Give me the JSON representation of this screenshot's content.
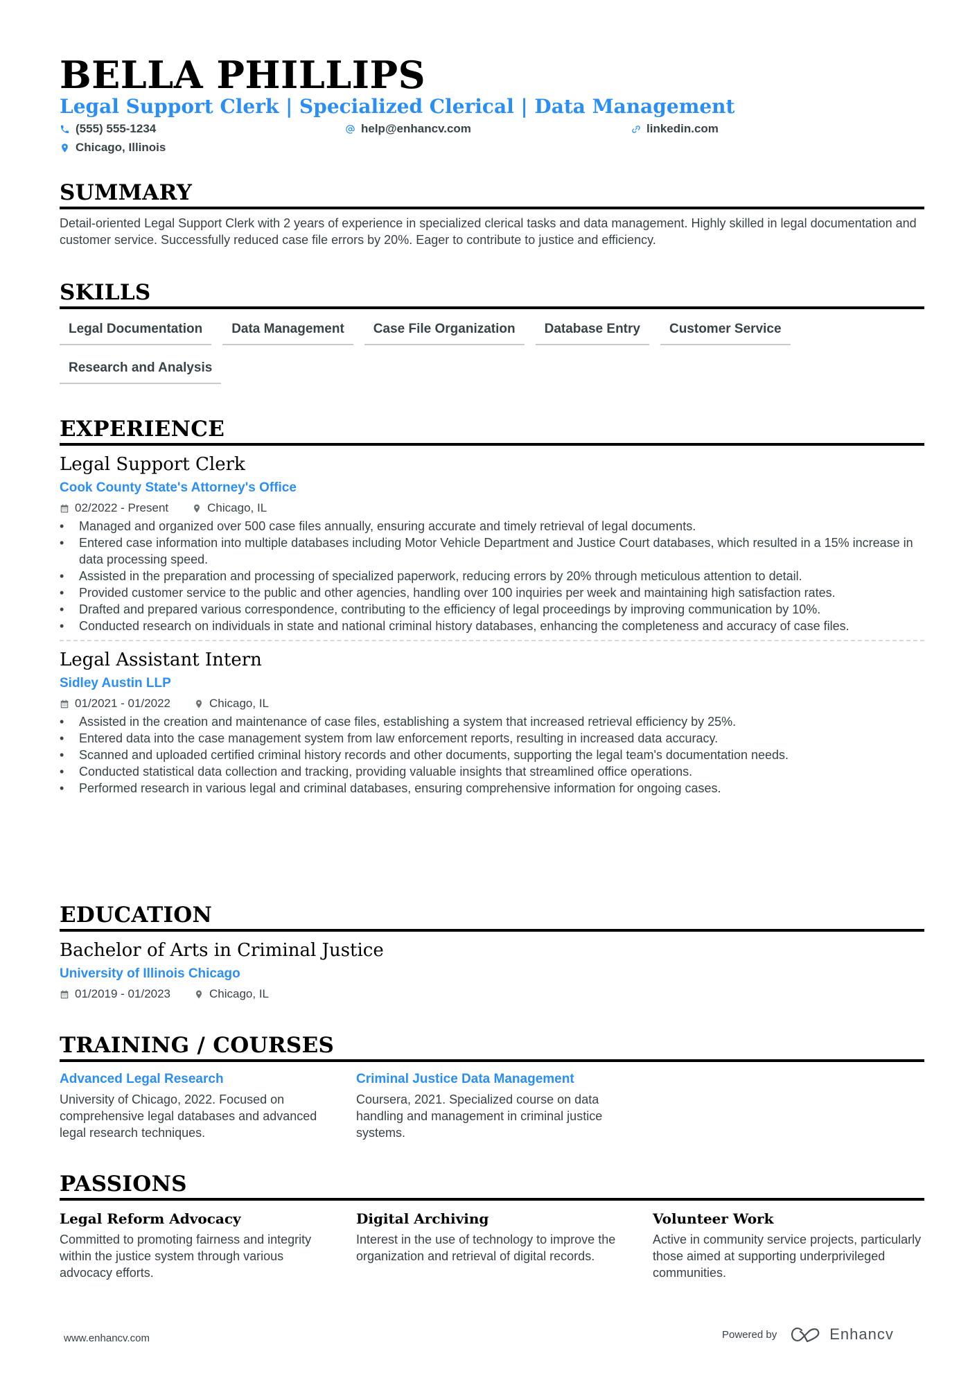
{
  "header": {
    "name": "BELLA PHILLIPS",
    "headline": "Legal Support Clerk | Specialized Clerical | Data Management",
    "contacts": {
      "phone": {
        "icon": "phone-icon",
        "value": "(555) 555-1234"
      },
      "email": {
        "icon": "at-icon",
        "value": "help@enhancv.com"
      },
      "linkedin": {
        "icon": "link-icon",
        "value": "linkedin.com"
      },
      "location": {
        "icon": "map-pin-icon",
        "value": "Chicago, Illinois"
      }
    }
  },
  "summary": {
    "title": "SUMMARY",
    "text": "Detail-oriented Legal Support Clerk with 2 years of experience in specialized clerical tasks and data management. Highly skilled in legal documentation and customer service. Successfully reduced case file errors by 20%. Eager to contribute to justice and efficiency."
  },
  "skills": {
    "title": "SKILLS",
    "items": [
      "Legal Documentation",
      "Data Management",
      "Case File Organization",
      "Database Entry",
      "Customer Service",
      "Research and Analysis"
    ]
  },
  "experience": {
    "title": "EXPERIENCE",
    "jobs": [
      {
        "title": "Legal Support Clerk",
        "company": "Cook County State's Attorney's Office",
        "dates": "02/2022 - Present",
        "location": "Chicago, IL",
        "bullets": [
          "Managed and organized over 500 case files annually, ensuring accurate and timely retrieval of legal documents.",
          "Entered case information into multiple databases including Motor Vehicle Department and Justice Court databases, which resulted in a 15% increase in data processing speed.",
          "Assisted in the preparation and processing of specialized paperwork, reducing errors by 20% through meticulous attention to detail.",
          "Provided customer service to the public and other agencies, handling over 100 inquiries per week and maintaining high satisfaction rates.",
          "Drafted and prepared various correspondence, contributing to the efficiency of legal proceedings by improving communication by 10%.",
          "Conducted research on individuals in state and national criminal history databases, enhancing the completeness and accuracy of case files."
        ]
      },
      {
        "title": "Legal Assistant Intern",
        "company": "Sidley Austin LLP",
        "dates": "01/2021 - 01/2022",
        "location": "Chicago, IL",
        "bullets": [
          "Assisted in the creation and maintenance of case files, establishing a system that increased retrieval efficiency by 25%.",
          "Entered data into the case management system from law enforcement reports, resulting in increased data accuracy.",
          "Scanned and uploaded certified criminal history records and other documents, supporting the legal team's documentation needs.",
          "Conducted statistical data collection and tracking, providing valuable insights that streamlined office operations.",
          "Performed research in various legal and criminal databases, ensuring comprehensive information for ongoing cases."
        ]
      }
    ]
  },
  "education": {
    "title": "EDUCATION",
    "degree": "Bachelor of Arts in Criminal Justice",
    "school": "University of Illinois Chicago",
    "dates": "01/2019 - 01/2023",
    "location": "Chicago, IL"
  },
  "training": {
    "title": "TRAINING / COURSES",
    "items": [
      {
        "title": "Advanced Legal Research",
        "text": "University of Chicago, 2022. Focused on comprehensive legal databases and advanced legal research techniques."
      },
      {
        "title": "Criminal Justice Data Management",
        "text": "Coursera, 2021. Specialized course on data handling and management in criminal justice systems."
      }
    ]
  },
  "passions": {
    "title": "PASSIONS",
    "items": [
      {
        "title": "Legal Reform Advocacy",
        "text": "Committed to promoting fairness and integrity within the justice system through various advocacy efforts."
      },
      {
        "title": "Digital Archiving",
        "text": "Interest in the use of technology to improve the organization and retrieval of digital records."
      },
      {
        "title": "Volunteer Work",
        "text": "Active in community service projects, particularly those aimed at supporting underprivileged communities."
      }
    ]
  },
  "footer": {
    "website": "www.enhancv.com",
    "powered_by": "Powered by",
    "brand": "Enhancv"
  },
  "colors": {
    "accent": "#2B8EF5",
    "text": "#384347",
    "heading": "#000000"
  }
}
